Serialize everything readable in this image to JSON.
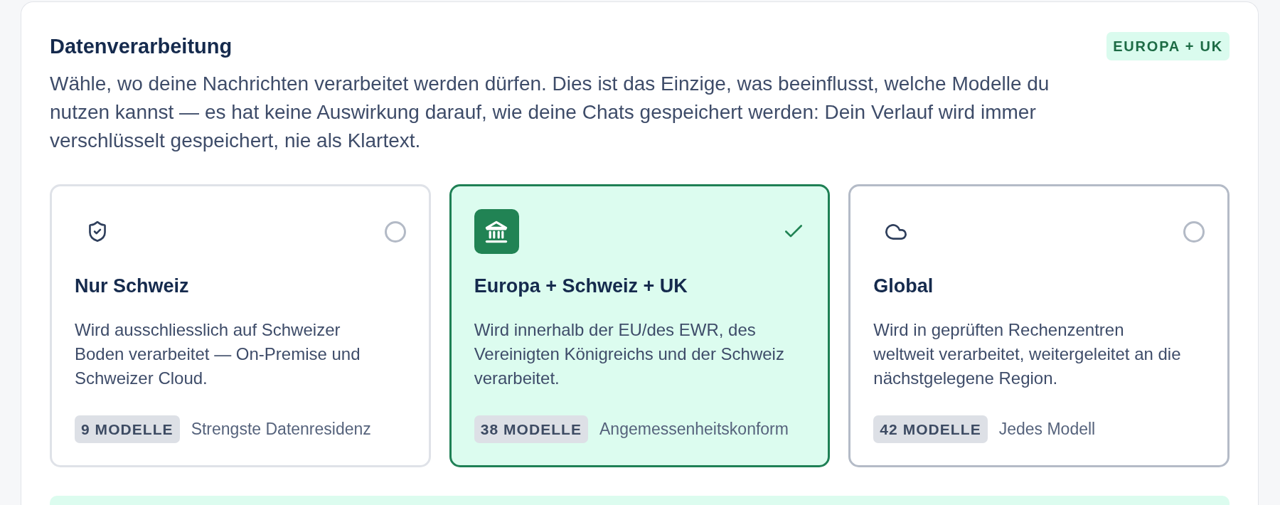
{
  "section": {
    "title": "Datenverarbeitung",
    "badge": "EUROPA + UK",
    "description": "Wähle, wo deine Nachrichten verarbeitet werden dürfen. Dies ist das Einzige, was beeinflusst, welche Modelle du nutzen kannst — es hat keine Auswirkung darauf, wie deine Chats gespeichert werden: Dein Verlauf wird immer verschlüsselt gespeichert, nie als Klartext."
  },
  "options": [
    {
      "title": "Nur Schweiz",
      "description": "Wird ausschliesslich auf Schweizer Boden verarbeitet — On-Premise und Schweizer Cloud.",
      "models": "9 MODELLE",
      "note": "Strengste Datenresidenz",
      "selected": false,
      "hovered": false
    },
    {
      "title": "Europa + Schweiz + UK",
      "description": "Wird innerhalb der EU/des EWR, des Vereinigten Königreichs und der Schweiz verarbeitet.",
      "models": "38 MODELLE",
      "note": "Angemessenheitskonform",
      "selected": true,
      "hovered": false
    },
    {
      "title": "Global",
      "description": "Wird in geprüften Rechenzentren weltweit verarbeitet, weitergeleitet an die nächstgelegene Region.",
      "models": "42 MODELLE",
      "note": "Jedes Modell",
      "selected": false,
      "hovered": true
    }
  ]
}
